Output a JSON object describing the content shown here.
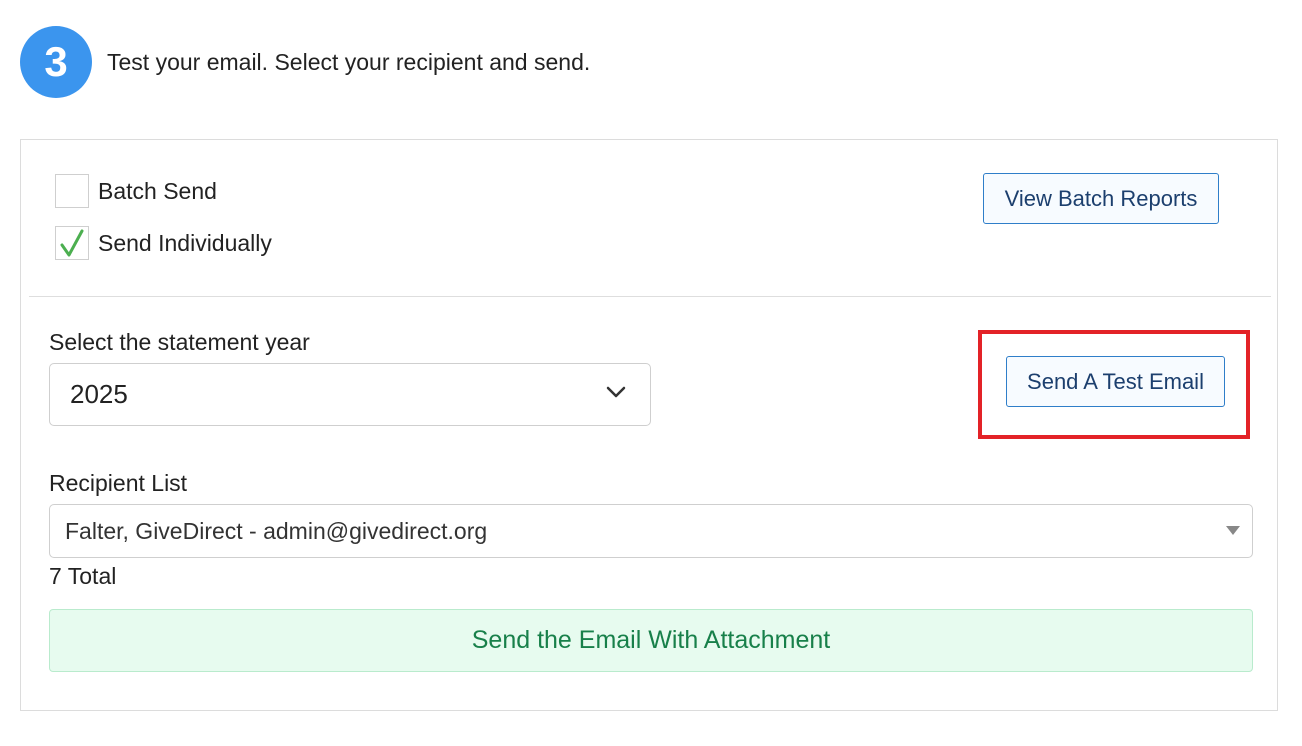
{
  "step": {
    "number": "3",
    "instruction": "Test your email. Select your recipient and send."
  },
  "send_mode": {
    "batch_label": "Batch Send",
    "batch_checked": false,
    "individual_label": "Send Individually",
    "individual_checked": true
  },
  "buttons": {
    "view_batch_reports": "View Batch Reports",
    "send_test_email": "Send A Test Email",
    "send_with_attachment": "Send the Email With Attachment"
  },
  "statement_year": {
    "label": "Select the statement year",
    "value": "2025"
  },
  "recipients": {
    "label": "Recipient List",
    "selected": "Falter, GiveDirect - admin@givedirect.org",
    "total": "7 Total"
  },
  "colors": {
    "step_circle": "#3b95ee",
    "check_mark": "#4caf50",
    "highlight_border": "#e32227",
    "primary_outline": "#2f7ec9",
    "success_bg": "#e7fbef",
    "success_text": "#18804a"
  }
}
